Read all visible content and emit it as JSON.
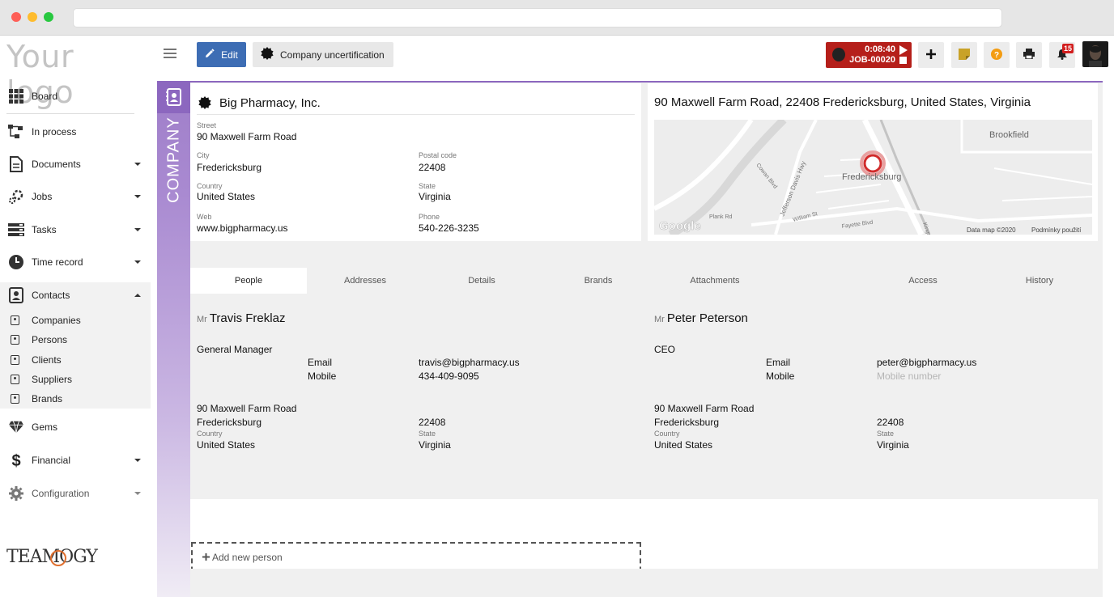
{
  "sidebar": {
    "logo": "Your logo",
    "items": [
      {
        "label": "Board",
        "icon": "grid-icon"
      },
      {
        "label": "In process",
        "icon": "flow-icon"
      },
      {
        "label": "Documents",
        "icon": "document-icon"
      },
      {
        "label": "Jobs",
        "icon": "jobs-icon"
      },
      {
        "label": "Tasks",
        "icon": "tasks-icon"
      },
      {
        "label": "Time record",
        "icon": "clock-icon"
      },
      {
        "label": "Contacts",
        "icon": "contacts-icon"
      },
      {
        "label": "Gems",
        "icon": "diamond-icon"
      },
      {
        "label": "Financial",
        "icon": "dollar-icon"
      },
      {
        "label": "Configuration",
        "icon": "gear-icon"
      }
    ],
    "contacts_sub": [
      "Companies",
      "Persons",
      "Clients",
      "Suppliers",
      "Brands"
    ],
    "brand_footer": "TEAMOGY"
  },
  "toolbar": {
    "edit_label": "Edit",
    "uncert_label": "Company uncertification",
    "timer_time": "0:08:40",
    "timer_job": "JOB-00020",
    "notifications_count": "15",
    "accent_color": "#3d6db4",
    "timer_color": "#b51f1a"
  },
  "section_label": "COMPANY",
  "company": {
    "name": "Big Pharmacy, Inc.",
    "street_label": "Street",
    "street": "90  Maxwell Farm Road",
    "city_label": "City",
    "city": "Fredericksburg",
    "postal_label": "Postal code",
    "postal": "22408",
    "country_label": "Country",
    "country": "United States",
    "state_label": "State",
    "state": "Virginia",
    "web_label": "Web",
    "web": "www.bigpharmacy.us",
    "phone_label": "Phone",
    "phone": "540-226-3235"
  },
  "map": {
    "title": "90 Maxwell Farm Road, 22408 Fredericksburg, United States, Virginia",
    "labels": {
      "brookfield": "Brookfield",
      "fredericksburg": "Fredericksburg",
      "jefferson": "Jefferson Davis Hwy",
      "cowan": "Cowan Blvd",
      "plank": "Plank Rd",
      "william": "William St",
      "fayette": "Fayette Blvd",
      "kings": "Kings Hwy",
      "google": "Google",
      "data": "Data map ©2020",
      "terms": "Podmínky použití"
    }
  },
  "tabs": [
    "People",
    "Addresses",
    "Details",
    "Brands",
    "Attachments",
    "Access",
    "History"
  ],
  "people": [
    {
      "title": "Mr",
      "name": "Travis Freklaz",
      "position": "General Manager",
      "email_label": "Email",
      "email": "travis@bigpharmacy.us",
      "mobile_label": "Mobile",
      "mobile": "434-409-9095",
      "street": "90  Maxwell Farm Road",
      "city": "Fredericksburg",
      "postal": "22408",
      "country_label": "Country",
      "country": "United States",
      "state_label": "State",
      "state": "Virginia"
    },
    {
      "title": "Mr",
      "name": "Peter Peterson",
      "position": "CEO",
      "email_label": "Email",
      "email": "peter@bigpharmacy.us",
      "mobile_label": "Mobile",
      "mobile_placeholder": "Mobile number",
      "street": "90  Maxwell Farm Road",
      "city": "Fredericksburg",
      "postal": "22408",
      "country_label": "Country",
      "country": "United States",
      "state_label": "State",
      "state": "Virginia"
    }
  ],
  "add_person": "Add new person"
}
